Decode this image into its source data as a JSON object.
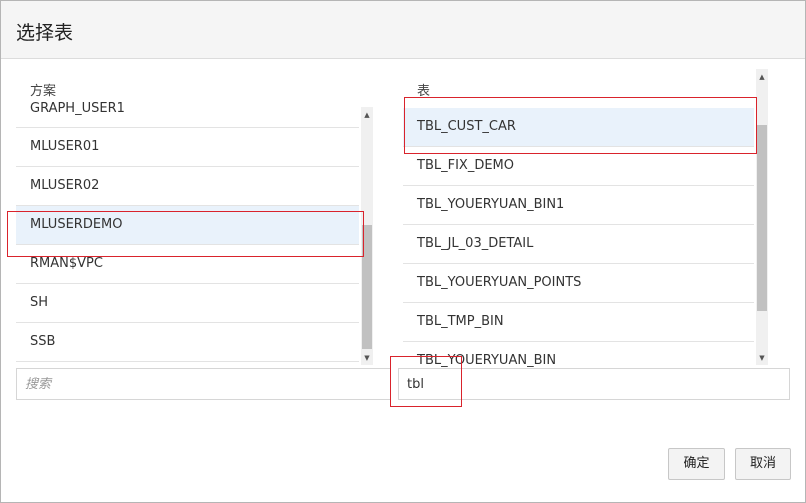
{
  "dialog": {
    "title": "选择表"
  },
  "schema_panel": {
    "header": "方案",
    "items": [
      {
        "label": "GRAPH_USER1",
        "selected": false
      },
      {
        "label": "MLUSER01",
        "selected": false
      },
      {
        "label": "MLUSER02",
        "selected": false
      },
      {
        "label": "MLUSERDEMO",
        "selected": true
      },
      {
        "label": "RMAN$VPC",
        "selected": false
      },
      {
        "label": "SH",
        "selected": false
      },
      {
        "label": "SSB",
        "selected": false
      }
    ],
    "search": {
      "value": "",
      "placeholder": "搜索"
    }
  },
  "table_panel": {
    "header": "表",
    "items": [
      {
        "label": "TBL_CUST_CAR",
        "selected": true
      },
      {
        "label": "TBL_FIX_DEMO",
        "selected": false
      },
      {
        "label": "TBL_YOUERYUAN_BIN1",
        "selected": false
      },
      {
        "label": "TBL_JL_03_DETAIL",
        "selected": false
      },
      {
        "label": "TBL_YOUERYUAN_POINTS",
        "selected": false
      },
      {
        "label": "TBL_TMP_BIN",
        "selected": false
      },
      {
        "label": "TBL_YOUERYUAN_BIN",
        "selected": false
      }
    ],
    "search": {
      "value": "tbl",
      "placeholder": ""
    }
  },
  "buttons": {
    "ok_label": "确定",
    "cancel_label": "取消"
  },
  "colors": {
    "highlight": "#d9232c",
    "selected_row": "#e9f2fb"
  }
}
